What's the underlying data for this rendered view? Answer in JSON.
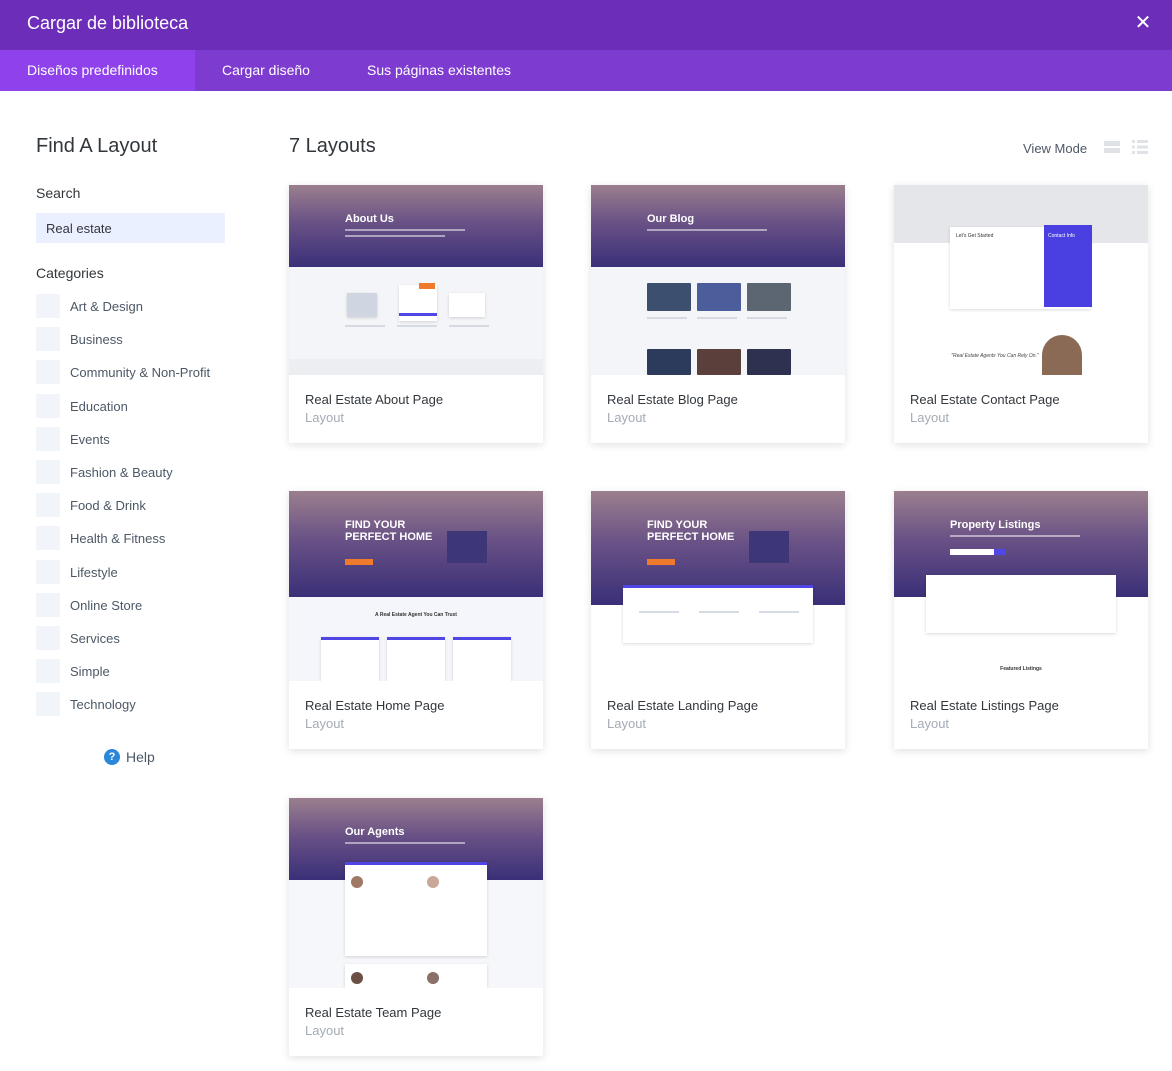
{
  "header": {
    "title": "Cargar de biblioteca",
    "close_label": "✕"
  },
  "tabs": [
    {
      "label": "Diseños predefinidos",
      "active": true
    },
    {
      "label": "Cargar diseño",
      "active": false
    },
    {
      "label": "Sus páginas existentes",
      "active": false
    }
  ],
  "sidebar": {
    "title": "Find A Layout",
    "search_label": "Search",
    "search_value": "Real estate",
    "categories_label": "Categories",
    "categories": [
      "Art & Design",
      "Business",
      "Community & Non-Profit",
      "Education",
      "Events",
      "Fashion & Beauty",
      "Food & Drink",
      "Health & Fitness",
      "Lifestyle",
      "Online Store",
      "Services",
      "Simple",
      "Technology"
    ],
    "help_label": "Help"
  },
  "main": {
    "title": "7 Layouts",
    "view_mode_label": "View Mode",
    "layouts": [
      {
        "name": "Real Estate About Page",
        "type": "Layout",
        "hero": "About Us"
      },
      {
        "name": "Real Estate Blog Page",
        "type": "Layout",
        "hero": "Our Blog"
      },
      {
        "name": "Real Estate Contact Page",
        "type": "Layout",
        "hero": "Let's Get Started",
        "sub": "Contact Info",
        "quote": "\"Real Estate Agents You Can Rely On.\""
      },
      {
        "name": "Real Estate Home Page",
        "type": "Layout",
        "hero": "FIND YOUR\nPERFECT HOME",
        "sub": "A Real Estate Agent You Can Trust"
      },
      {
        "name": "Real Estate Landing Page",
        "type": "Layout",
        "hero": "FIND YOUR\nPERFECT HOME"
      },
      {
        "name": "Real Estate Listings Page",
        "type": "Layout",
        "hero": "Property Listings",
        "sub": "Featured Listings"
      },
      {
        "name": "Real Estate Team Page",
        "type": "Layout",
        "hero": "Our Agents"
      }
    ]
  },
  "colors": {
    "header": "#6c2eb9",
    "tabs": "#7e3bd0",
    "active_tab": "#8f42ec",
    "accent": "#4f46e5",
    "help": "#2b87da"
  }
}
